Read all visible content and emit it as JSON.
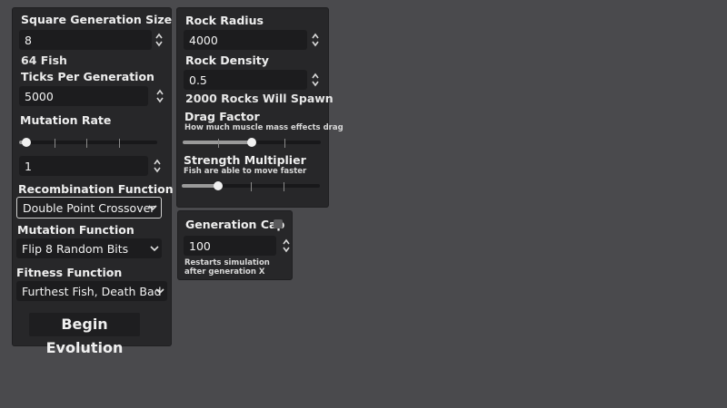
{
  "left_panel": {
    "square_generation_size": {
      "label": "Square Generation Size",
      "value": "8"
    },
    "fish_count_text": "64 Fish",
    "ticks_per_generation": {
      "label": "Ticks Per Generation",
      "value": "5000"
    },
    "mutation_rate": {
      "label": "Mutation Rate",
      "slider_fraction": 0.05,
      "value": "1"
    },
    "recombination_function": {
      "label": "Recombination Function",
      "selected": "Double Point Crossover"
    },
    "mutation_function": {
      "label": "Mutation Function",
      "selected": "Flip 8 Random Bits"
    },
    "fitness_function": {
      "label": "Fitness Function",
      "selected": "Furthest Fish, Death Bad"
    },
    "begin_button": "Begin Evolution"
  },
  "right_panel": {
    "rock_radius": {
      "label": "Rock Radius",
      "value": "4000"
    },
    "rock_density": {
      "label": "Rock Density",
      "value": "0.5"
    },
    "rocks_spawn_text": "2000 Rocks Will Spawn",
    "drag_factor": {
      "label": "Drag Factor",
      "hint": "How much muscle mass effects drag",
      "slider_fraction": 0.5
    },
    "strength_multiplier": {
      "label": "Strength Multiplier",
      "hint": "Fish are able to move faster",
      "slider_fraction": 0.26
    }
  },
  "generation_panel": {
    "label": "Generation Cap",
    "enabled": false,
    "value": "100",
    "hint": "Restarts simulation after generation X"
  },
  "icons": {
    "spin": "spin-arrows-icon",
    "dropdown": "chevron-down-icon",
    "checkbox": "checkbox"
  },
  "colors": {
    "background": "#4a4a4d",
    "panel": "#272729",
    "field": "#1c1c1e",
    "text": "#eeeeee"
  }
}
